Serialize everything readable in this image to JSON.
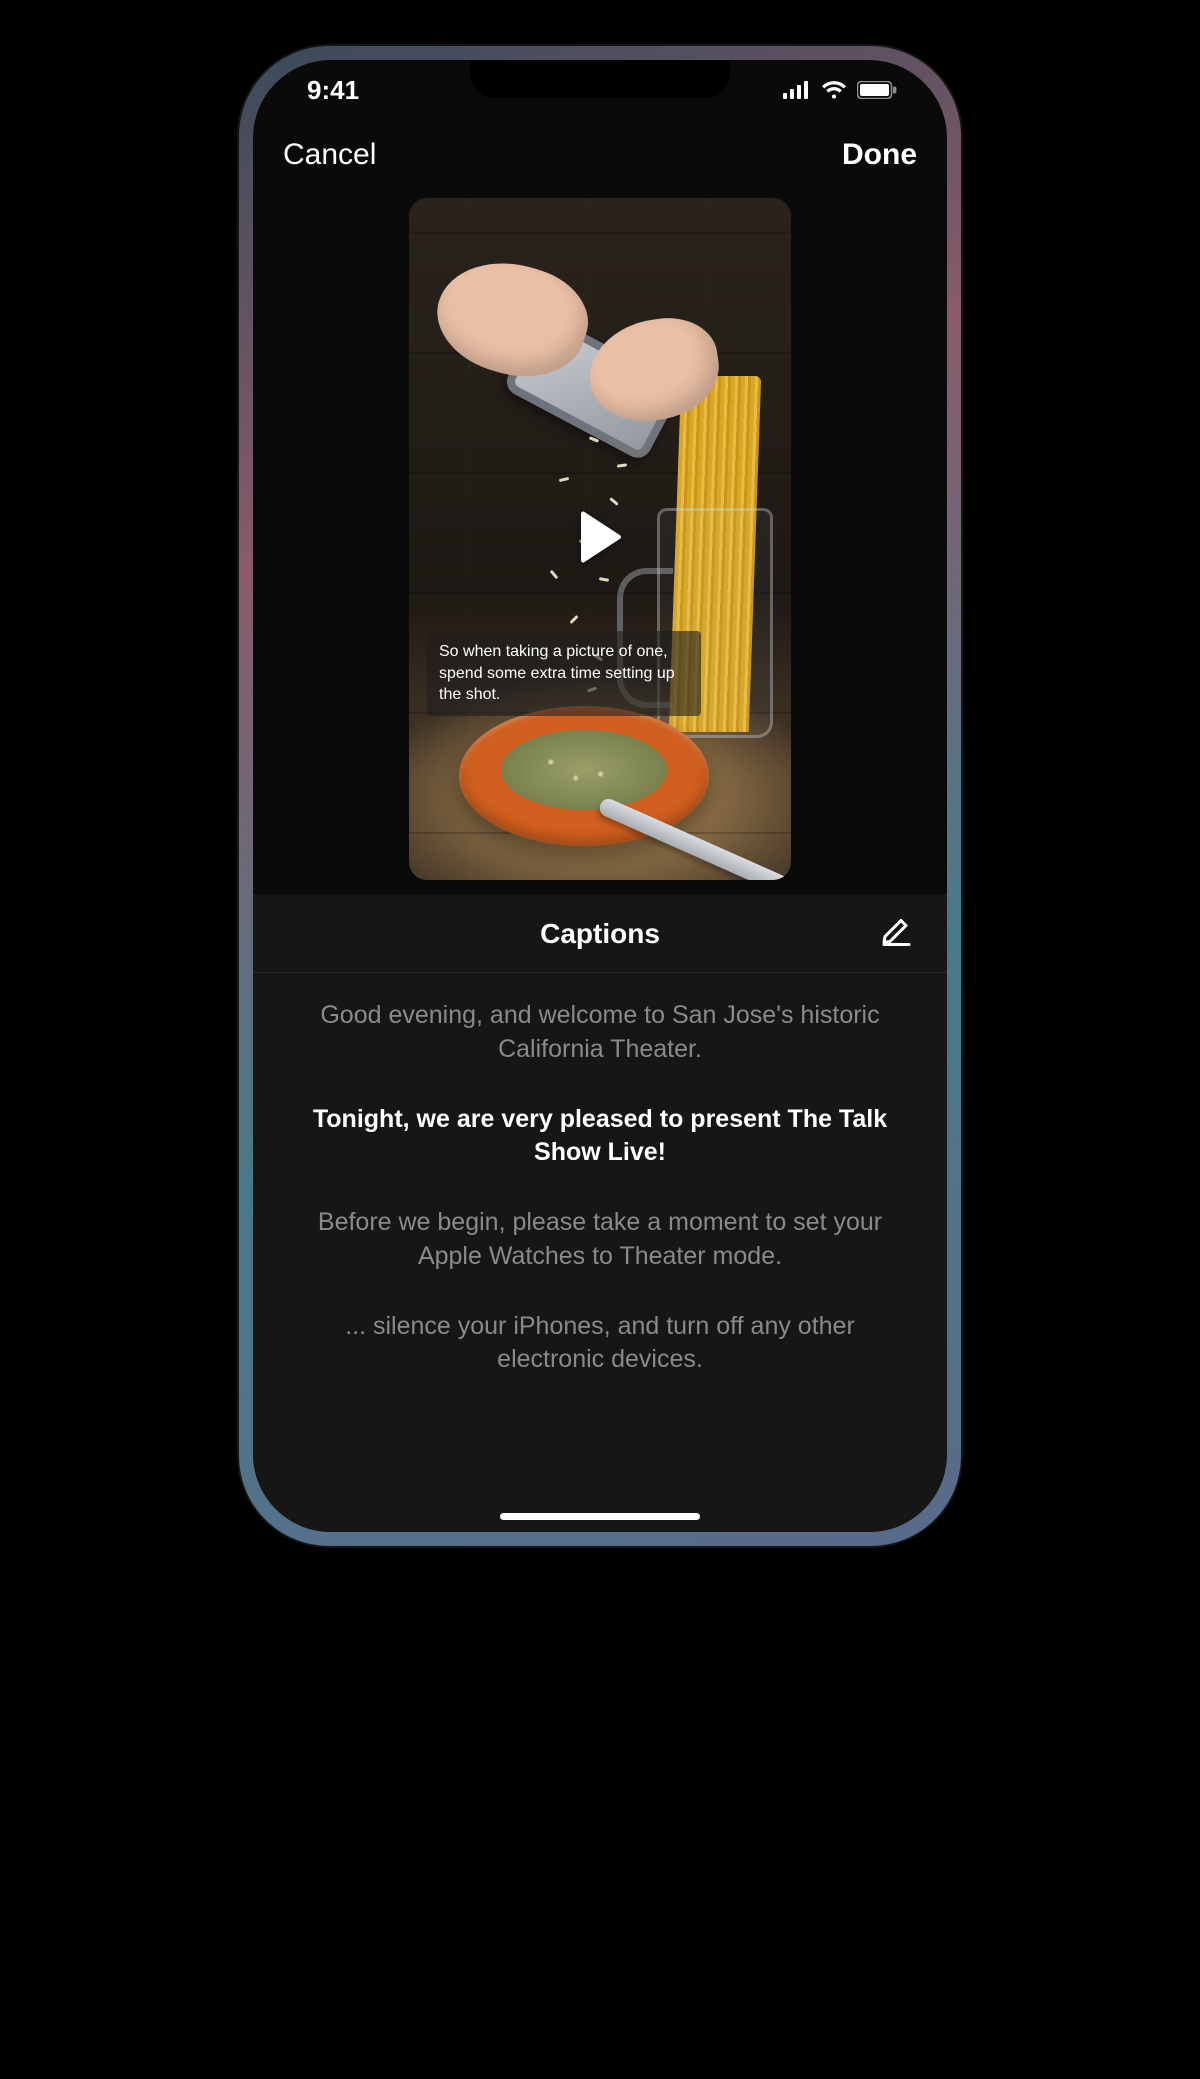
{
  "status": {
    "time": "9:41"
  },
  "nav": {
    "cancel": "Cancel",
    "done": "Done"
  },
  "preview": {
    "overlay_caption": "So when taking a picture of one, spend some extra time setting up the shot."
  },
  "captions": {
    "title": "Captions",
    "lines": [
      {
        "text": "Good evening, and welcome to San Jose's historic California Theater.",
        "active": false
      },
      {
        "text": "Tonight, we are very pleased to present The Talk Show Live!",
        "active": true
      },
      {
        "text": "Before we begin, please take a moment to set your Apple Watches to Theater mode.",
        "active": false
      },
      {
        "text": "... silence your iPhones, and turn off any other electronic devices.",
        "active": false
      }
    ]
  }
}
